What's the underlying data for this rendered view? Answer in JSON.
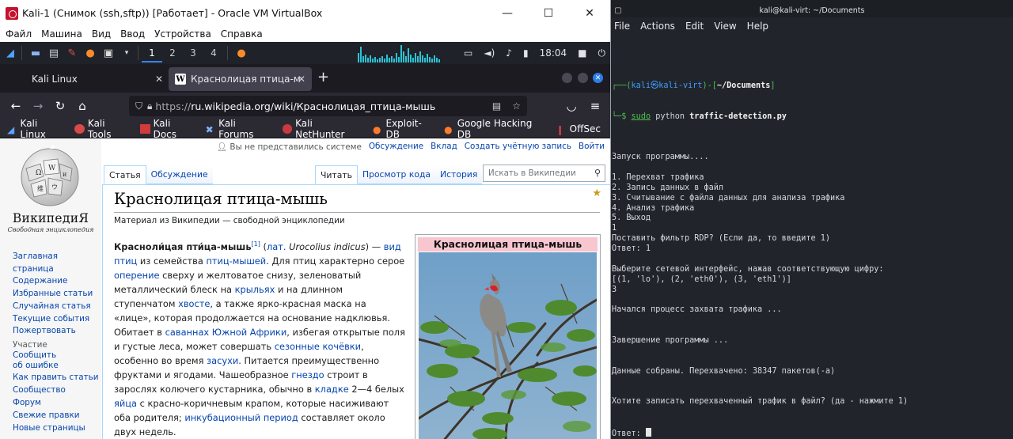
{
  "vbox": {
    "title": "Kali-1 (Снимок (ssh,sftp)) [Работает] - Oracle VM VirtualBox",
    "menu": [
      "Файл",
      "Машина",
      "Вид",
      "Ввод",
      "Устройства",
      "Справка"
    ],
    "controls": {
      "minimize": "—",
      "maximize": "☐",
      "close": "✕"
    }
  },
  "kali_panel": {
    "workspaces": [
      "1",
      "2",
      "3",
      "4"
    ],
    "clock": "18:04"
  },
  "firefox": {
    "tabs": [
      {
        "label": "Kali Linux"
      },
      {
        "label": "Краснолицая птица-мышь"
      }
    ],
    "url_proto": "https://",
    "url_rest": "ru.wikipedia.org/wiki/Краснолицая_птица-мышь",
    "bookmarks": [
      "Kali Linux",
      "Kali Tools",
      "Kali Docs",
      "Kali Forums",
      "Kali NetHunter",
      "Exploit-DB",
      "Google Hacking DB",
      "OffSec"
    ]
  },
  "wiki": {
    "logo_word": "ВикипедиЯ",
    "logo_sub": "Свободная энциклопедия",
    "personal": {
      "anon": "Вы не представились системе",
      "links": [
        "Обсуждение",
        "Вклад",
        "Создать учётную запись",
        "Войти"
      ]
    },
    "tabs_left": [
      "Статья",
      "Обсуждение"
    ],
    "tabs_right": [
      "Читать",
      "Просмотр кода",
      "История"
    ],
    "search_placeholder": "Искать в Википедии",
    "side_main": [
      "Заглавная страница",
      "Содержание",
      "Избранные статьи",
      "Случайная статья",
      "Текущие события",
      "Пожертвовать"
    ],
    "side_heading": "Участие",
    "side_participate": [
      "Сообщить об ошибке",
      "Как править статьи",
      "Сообщество",
      "Форум",
      "Свежие правки",
      "Новые страницы"
    ],
    "heading": "Краснолицая птица-мышь",
    "from": "Материал из Википедии — свободной энциклопедии",
    "infobox_title": "Краснолицая птица-мышь",
    "article": {
      "bold": "Красноли́цая пти́ца-мышь",
      "sup": "[1]",
      "t1": " (",
      "lat": "лат.",
      "latname": " Urocolius indicus",
      "t2": ") — ",
      "l1": "вид птиц",
      "t3": " из семейства ",
      "l2": "птиц-мышей",
      "t4": ". Для птиц характерно серое ",
      "l3": "оперение",
      "t5": " сверху и желтоватое снизу, зеленоватый металлический блеск на ",
      "l4": "крыльях",
      "t6": " и на длинном ступенчатом ",
      "l5": "хвосте",
      "t7": ", а также ярко-красная маска на «лице», которая продолжается на основание надклювья. Обитает в ",
      "l6": "саваннах Южной Африки",
      "t8": ", избегая открытые поля и густые леса, может совершать ",
      "l7": "сезонные кочёвки",
      "t9": ", особенно во время ",
      "l8": "засухи",
      "t10": ". Питается преимущественно фруктами и ягодами. Чашеобразное ",
      "l9": "гнездо",
      "t11": " строит в зарослях колючего кустарника, обычно в ",
      "l10": "кладке",
      "t12": " 2—4 белых ",
      "l11": "яйца",
      "t13": " с красно-коричневым крапом, которые насиживают оба родителя; ",
      "l12": "инкубационный период",
      "t14": " составляет около двух недель."
    }
  },
  "terminal": {
    "title": "kali@kali-virt: ~/Documents",
    "menu": [
      "File",
      "Actions",
      "Edit",
      "View",
      "Help"
    ],
    "prompt_user": "kali",
    "prompt_at": "㉿",
    "prompt_host": "kali-virt",
    "prompt_dir": "~/Documents",
    "prompt_frame_open": "┌──(",
    "prompt_frame_mid": ")-[",
    "prompt_frame_close": "]",
    "prompt_arrow": "└─$ ",
    "cmd_sudo": "sudo",
    "cmd_python": " python ",
    "cmd_file": "traffic-detection.py",
    "output": [
      "",
      "Запуск программы....",
      "",
      "1. Перехват трафика",
      "2. Запись данных в файл",
      "3. Считывание с файла данных для анализа трафика",
      "4. Анализ трафика",
      "5. Выход",
      "1",
      "Поставить фильтр RDP? (Если да, то введите 1)",
      "Ответ: 1",
      "",
      "Выберите сетевой интерфейс, нажав соответствующую цифру:",
      "[(1, 'lo'), (2, 'eth0'), (3, 'eth1')]",
      "3",
      "",
      "Начался процесс захвата трафика ...",
      "",
      "",
      "Завершение программы ...",
      "",
      "",
      "Данные собраны. Перехвачено: 38347 пакетов(-а)",
      "",
      "",
      "Хотите записать перехваченный трафик в файл? (да - нажмите 1)"
    ],
    "last_prompt": "Ответ: "
  }
}
